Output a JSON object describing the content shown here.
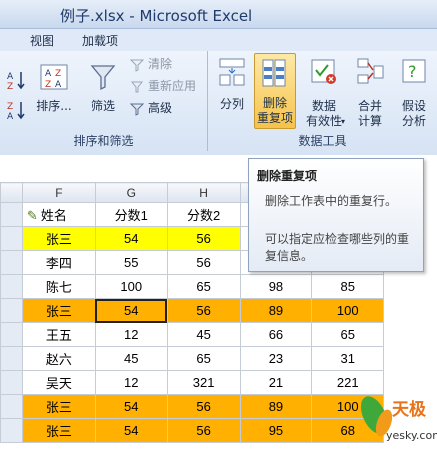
{
  "window": {
    "title": "例子.xlsx - Microsoft Excel"
  },
  "tabs": [
    "视图",
    "加载项"
  ],
  "ribbon": {
    "sort_filter": {
      "group_label": "排序和筛选",
      "sort_label": "排序...",
      "filter_label": "筛选",
      "clear_label": "清除",
      "reapply_label": "重新应用",
      "advanced_label": "高级"
    },
    "data_tools": {
      "group_label": "数据工具",
      "text_to_columns_line1": "分列",
      "remove_dup_line1": "删除",
      "remove_dup_line2": "重复项",
      "validation_line1": "数据",
      "validation_line2": "有效性",
      "consolidate_line1": "合并",
      "consolidate_line2": "计算",
      "what_if_line1": "假设",
      "what_if_line2": "分析"
    }
  },
  "tooltip": {
    "title": "删除重复项",
    "body": "删除工作表中的重复行。",
    "note": "可以指定应检查哪些列的重复信息。"
  },
  "sheet": {
    "columns": [
      "F",
      "G",
      "H"
    ],
    "rows": [
      {
        "name": "姓名",
        "s1": "分数1",
        "s2": "分数2",
        "s3": "",
        "s4": ""
      },
      {
        "name": "张三",
        "s1": "54",
        "s2": "56",
        "s3": "",
        "s4": ""
      },
      {
        "name": "李四",
        "s1": "55",
        "s2": "56",
        "s3": "",
        "s4": ""
      },
      {
        "name": "陈七",
        "s1": "100",
        "s2": "65",
        "s3": "98",
        "s4": "85"
      },
      {
        "name": "张三",
        "s1": "54",
        "s2": "56",
        "s3": "89",
        "s4": "100"
      },
      {
        "name": "王五",
        "s1": "12",
        "s2": "45",
        "s3": "66",
        "s4": "65"
      },
      {
        "name": "赵六",
        "s1": "45",
        "s2": "65",
        "s3": "23",
        "s4": "31"
      },
      {
        "name": "吴天",
        "s1": "12",
        "s2": "321",
        "s3": "21",
        "s4": "221"
      },
      {
        "name": "张三",
        "s1": "54",
        "s2": "56",
        "s3": "89",
        "s4": "100"
      },
      {
        "name": "张三",
        "s1": "54",
        "s2": "56",
        "s3": "95",
        "s4": "68"
      }
    ],
    "colors": {
      "highlight_yellow": "#ffff00",
      "highlight_orange": "#ffb000"
    }
  },
  "watermark": {
    "text": "天极",
    "site": "yesky.com"
  }
}
